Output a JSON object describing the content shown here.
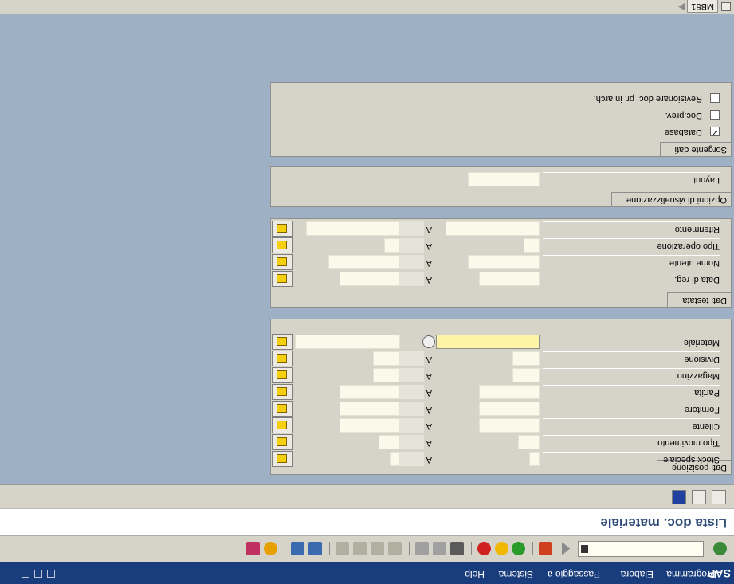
{
  "menu": {
    "items": [
      "Programma",
      "Elabora",
      "Passaggio a",
      "Sistema",
      "Help"
    ],
    "logo": "SAP"
  },
  "toolbar": {
    "command_value": "",
    "icons": [
      "ok-icon",
      "save-icon",
      "back-icon",
      "exit-icon",
      "cancel-icon",
      "print-icon",
      "find-icon",
      "find-next-icon",
      "first-page-icon",
      "prev-page-icon",
      "next-page-icon",
      "last-page-icon",
      "create-session-icon",
      "shortcut-icon",
      "help-icon",
      "layout-icon"
    ]
  },
  "title": "Lista doc. materiale",
  "app_toolbar": {
    "icons": [
      "execute-icon",
      "get-variant-icon",
      "info-icon"
    ]
  },
  "groups": {
    "dati_posizione": {
      "title": "Dati posizione",
      "rows": [
        {
          "label": "Materiale",
          "to": "A"
        },
        {
          "label": "Divisione",
          "to": "A"
        },
        {
          "label": "Magazzino",
          "to": "A"
        },
        {
          "label": "Partita",
          "to": "A"
        },
        {
          "label": "Fornitore",
          "to": "A"
        },
        {
          "label": "Cliente",
          "to": "A"
        },
        {
          "label": "Tipo movimento",
          "to": "A"
        },
        {
          "label": "Stock speciale",
          "to": "A"
        }
      ]
    },
    "dati_testata": {
      "title": "Dati testata",
      "rows": [
        {
          "label": "Data di reg.",
          "to": "A"
        },
        {
          "label": "Nome utente",
          "to": "A"
        },
        {
          "label": "Tipo operazione",
          "to": "A"
        },
        {
          "label": "Riferimento",
          "to": "A"
        }
      ]
    },
    "opzioni": {
      "title": "Opzioni di visualizzazione",
      "rows": [
        {
          "label": "Layout"
        }
      ]
    },
    "sorgente": {
      "title": "Sorgente dati",
      "options": [
        {
          "label": "Database",
          "checked": true
        },
        {
          "label": "Doc.prev.",
          "checked": false
        },
        {
          "label": "Revisionare doc. pr. in arch.",
          "checked": false
        }
      ]
    }
  },
  "status": {
    "system": "MB51"
  },
  "colors": {
    "menu_bg": "#183c7c",
    "frame_bg": "#d6d3c9",
    "canvas_bg": "#9eb0c3",
    "active_field": "#fff3a8"
  }
}
